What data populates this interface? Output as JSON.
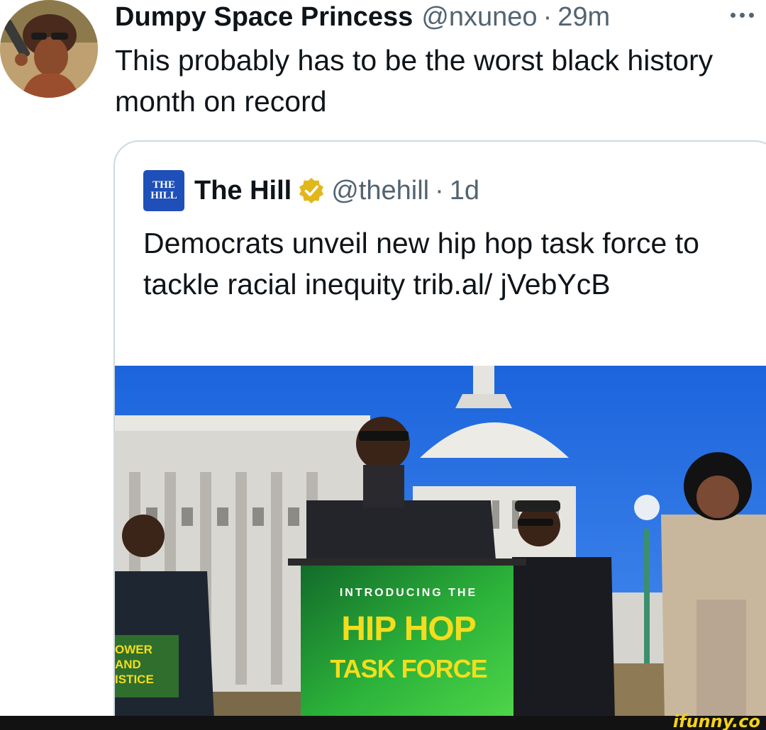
{
  "tweet": {
    "display_name": "Dumpy Space Princess",
    "handle": "@nxuneo",
    "separator": "·",
    "timestamp": "29m",
    "text": "This probably has to be the worst black history month on record",
    "avatar_icon": "avatar-photo",
    "more_icon": "more-options-icon"
  },
  "quoted_tweet": {
    "logo_line1": "THE",
    "logo_line2": "HILL",
    "display_name": "The Hill",
    "verified_icon": "gold-verified-badge-icon",
    "handle": "@thehill",
    "separator": "·",
    "timestamp": "1d",
    "text": "Democrats unveil new hip hop task force to tackle racial inequity trib.al/ jVebYcB",
    "media": {
      "description_icon": "press-conference-photo",
      "podium_sign_intro": "INTRODUCING THE",
      "podium_sign_title": "HIP HOP",
      "podium_sign_subtitle": "TASK FORCE",
      "side_sign_text": "OWER AND ISTICE"
    }
  },
  "watermark": {
    "text": "ifunny.co"
  },
  "colors": {
    "text_primary": "#0f1419",
    "text_secondary": "#536471",
    "border": "#cfd9de",
    "hill_blue": "#1f4fb8",
    "verified_gold": "#e2b719",
    "sky": "#1f6fe0",
    "sign_green": "#2fbf3f",
    "sign_yellow": "#f4dd1e"
  }
}
